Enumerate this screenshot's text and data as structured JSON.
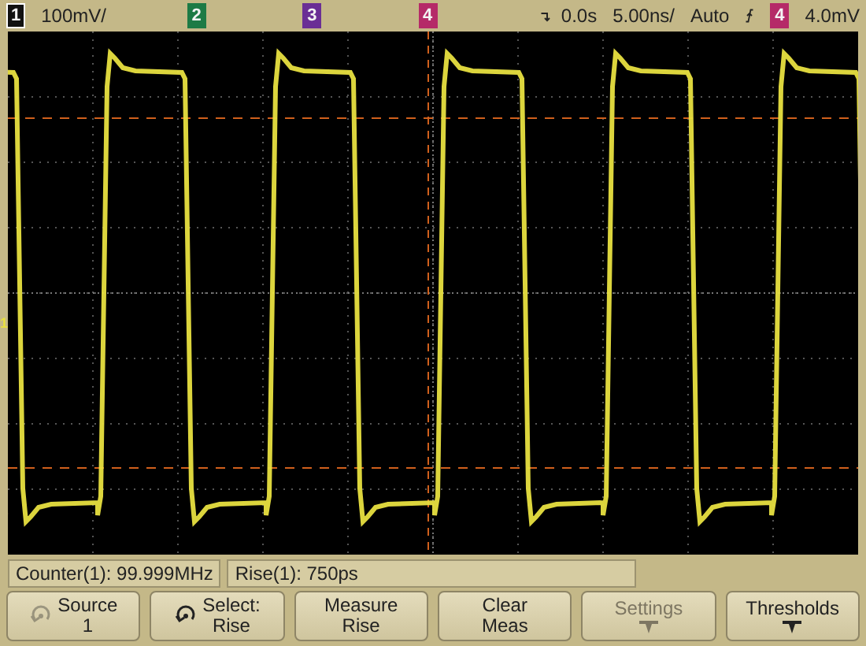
{
  "channels": [
    {
      "label": "1",
      "color": "#111111",
      "selected": true,
      "scale": "100mV/"
    },
    {
      "label": "2",
      "color": "#1d7a45",
      "selected": false
    },
    {
      "label": "3",
      "color": "#6a2e95",
      "selected": false
    },
    {
      "label": "4",
      "color": "#b52a68",
      "selected": false
    }
  ],
  "timebase": {
    "delay": "0.0s",
    "scale": "5.00ns/"
  },
  "trigger": {
    "mode": "Auto",
    "source": {
      "label": "4",
      "color": "#b52a68"
    },
    "level": "4.0mV"
  },
  "ground_marker": "1",
  "measurements": [
    "Counter(1): 99.999MHz",
    "Rise(1): 750ps"
  ],
  "softkeys": [
    {
      "kind": "knob-idle",
      "label": "Source",
      "value": "1",
      "disabled": false
    },
    {
      "kind": "knob",
      "label": "Select:",
      "value": "Rise",
      "disabled": false
    },
    {
      "kind": "plain",
      "label": "Measure",
      "value": "Rise",
      "disabled": false
    },
    {
      "kind": "plain",
      "label": "Clear",
      "value": "Meas",
      "disabled": false
    },
    {
      "kind": "submenu",
      "label": "Settings",
      "disabled": true
    },
    {
      "kind": "submenu",
      "label": "Thresholds",
      "disabled": false
    }
  ]
}
